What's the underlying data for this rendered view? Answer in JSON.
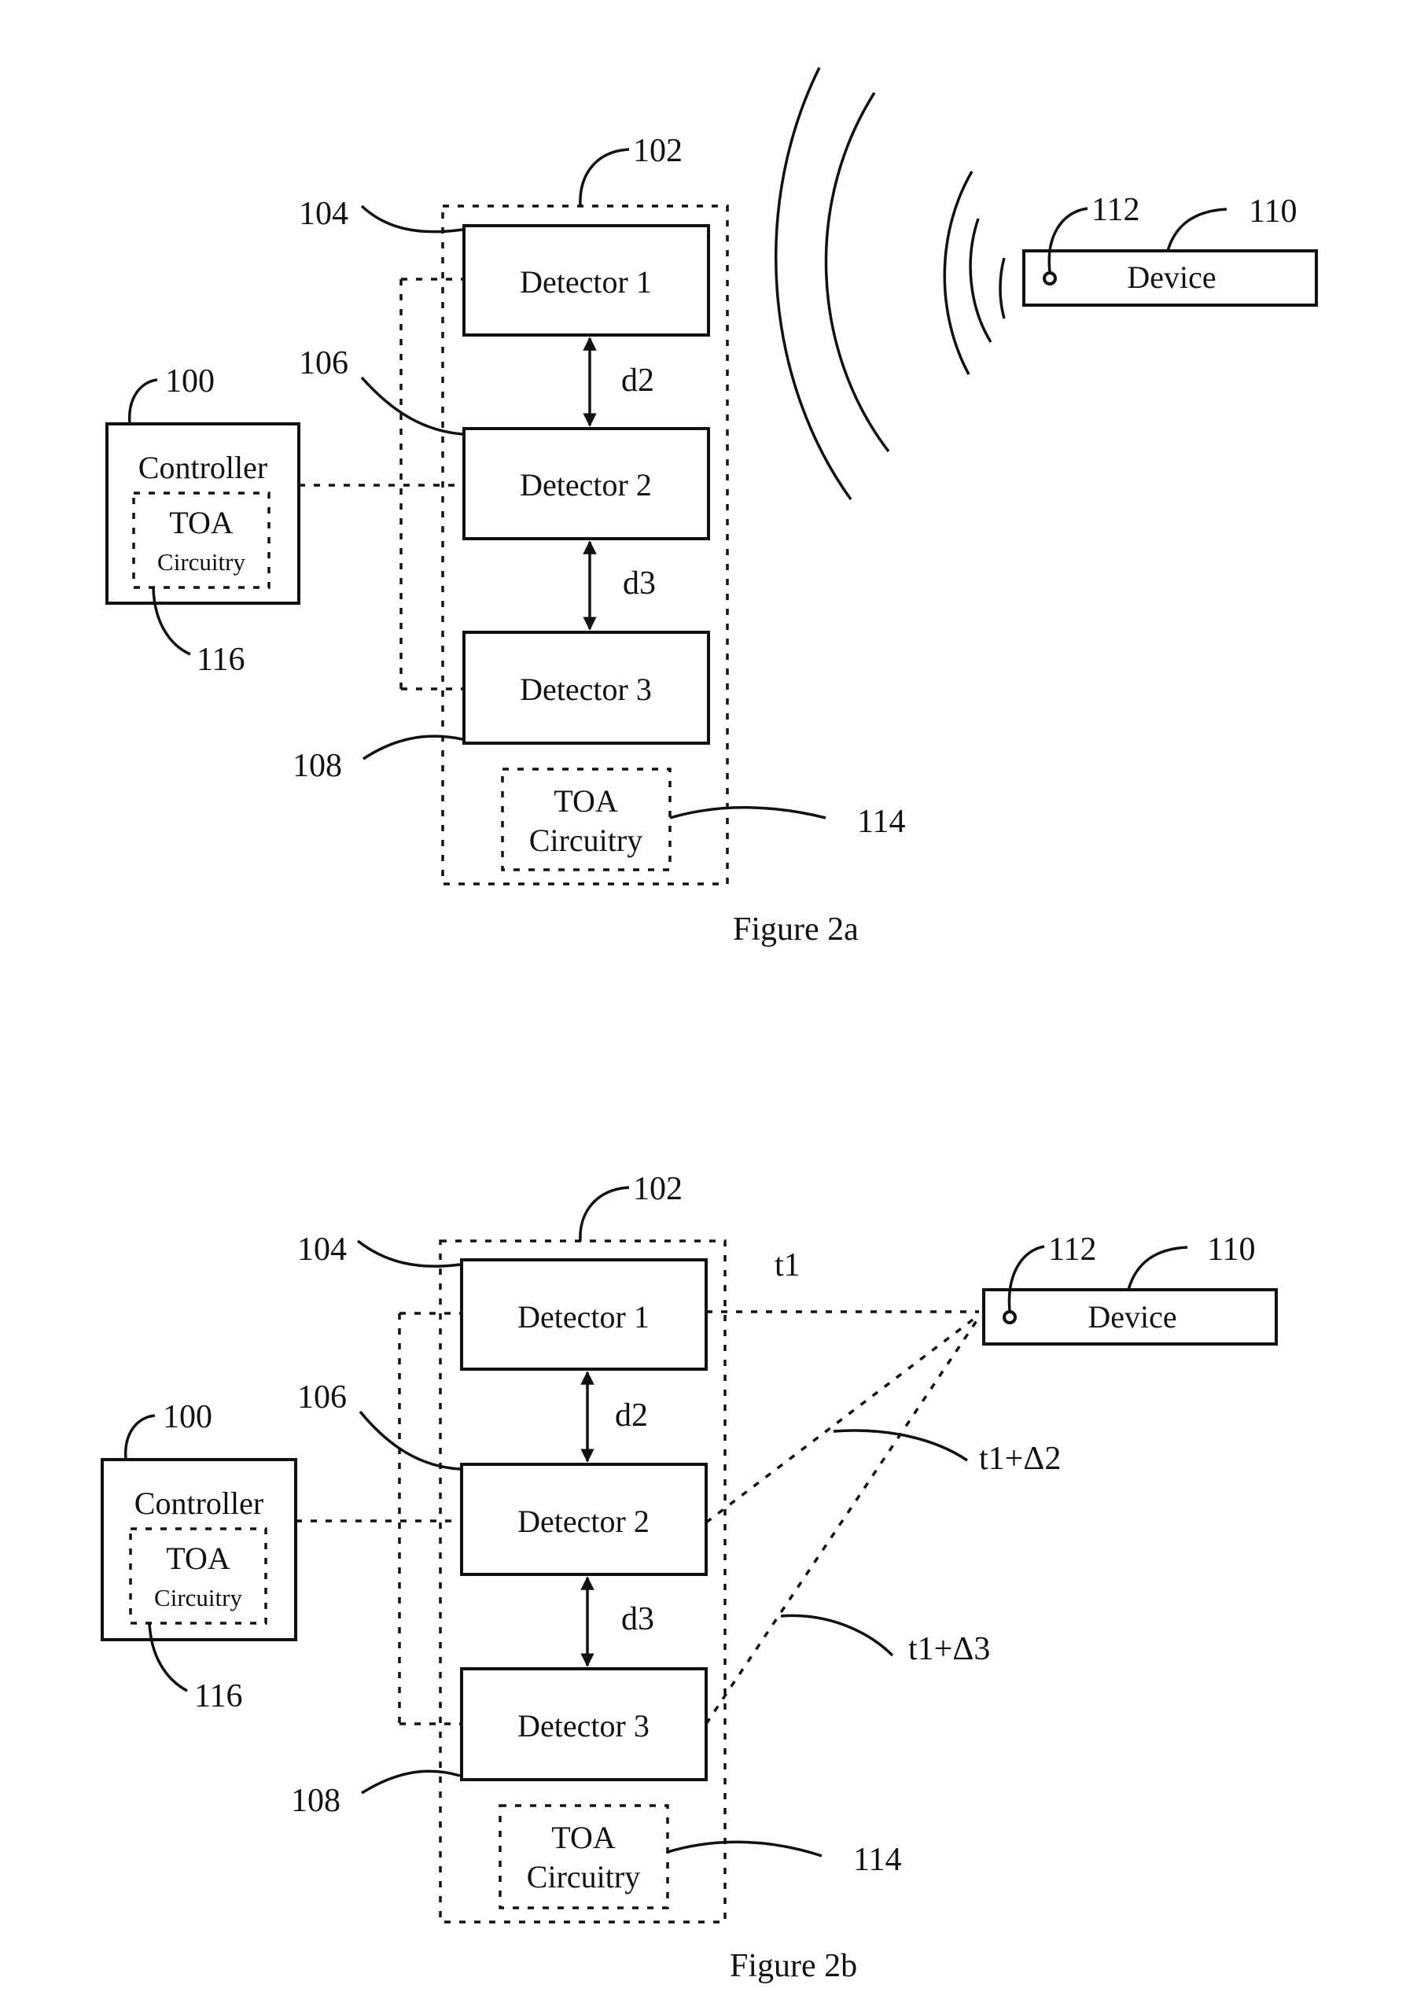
{
  "figures": [
    {
      "caption": "Figure 2a",
      "ref_system": "102",
      "controller": {
        "label": "Controller",
        "ref": "100",
        "toa_label_1": "TOA",
        "toa_label_2": "Circuitry",
        "toa_ref": "116"
      },
      "detectors": [
        {
          "label": "Detector 1",
          "ref": "104"
        },
        {
          "label": "Detector 2",
          "ref": "106"
        },
        {
          "label": "Detector 3",
          "ref": "108"
        }
      ],
      "distances": [
        "d2",
        "d3"
      ],
      "toa": {
        "label_1": "TOA",
        "label_2": "Circuitry",
        "ref": "114"
      },
      "device": {
        "label": "Device",
        "ref": "110",
        "emitter_ref": "112"
      },
      "signal_waves": 5
    },
    {
      "caption": "Figure 2b",
      "ref_system": "102",
      "controller": {
        "label": "Controller",
        "ref": "100",
        "toa_label_1": "TOA",
        "toa_label_2": "Circuitry",
        "toa_ref": "116"
      },
      "detectors": [
        {
          "label": "Detector 1",
          "ref": "104"
        },
        {
          "label": "Detector 2",
          "ref": "106"
        },
        {
          "label": "Detector 3",
          "ref": "108"
        }
      ],
      "distances": [
        "d2",
        "d3"
      ],
      "toa": {
        "label_1": "TOA",
        "label_2": "Circuitry",
        "ref": "114"
      },
      "device": {
        "label": "Device",
        "ref": "110",
        "emitter_ref": "112"
      },
      "arrival_times": [
        "t1",
        "t1+Δ2",
        "t1+Δ3"
      ]
    }
  ]
}
